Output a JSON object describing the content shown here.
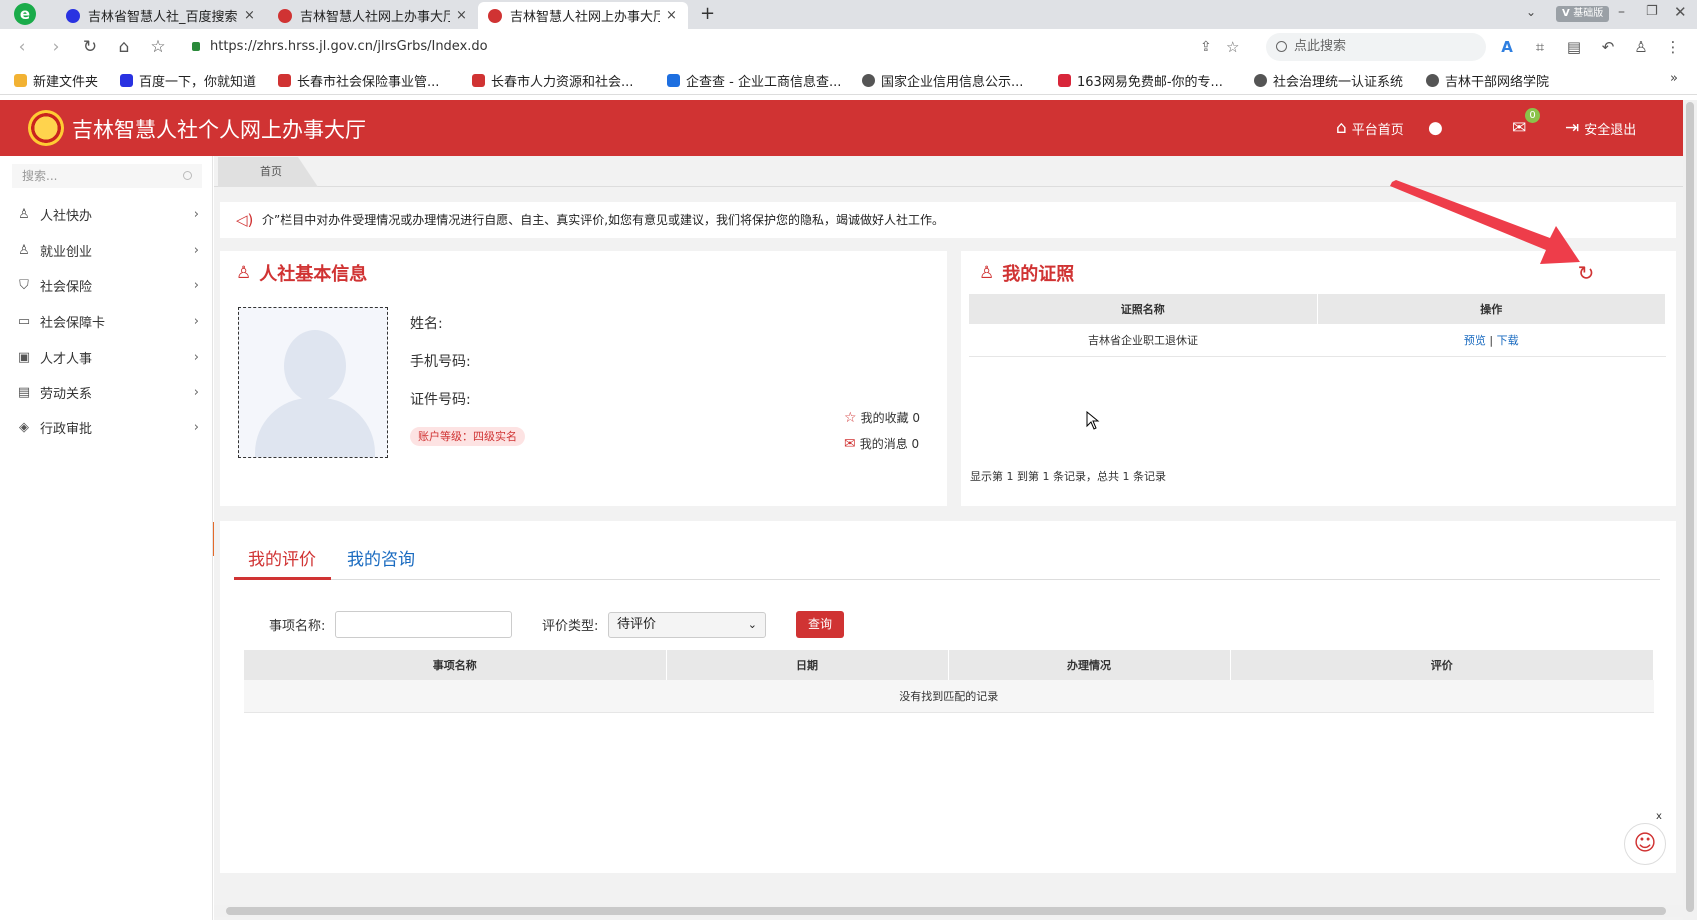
{
  "browser": {
    "tabs": [
      {
        "title": "吉林省智慧人社_百度搜索",
        "close": "×"
      },
      {
        "title": "吉林智慧人社网上办事大厅",
        "close": "×"
      },
      {
        "title": "吉林智慧人社网上办事大厅",
        "close": "×"
      }
    ],
    "new_tab": "+",
    "url": "https://zhrs.hrss.jl.gov.cn/jlrsGrbs/Index.do",
    "search_placeholder": "点此搜索",
    "version_badge": "基础版",
    "bookmarks": [
      "新建文件夹",
      "百度一下，你就知道",
      "长春市社会保险事业管...",
      "长春市人力资源和社会...",
      "企查查 - 企业工商信息查...",
      "国家企业信用信息公示...",
      "163网易免费邮-你的专...",
      "社会治理统一认证系统",
      "吉林干部网络学院"
    ]
  },
  "header": {
    "title": "吉林智慧人社个人网上办事大厅",
    "home_label": "平台首页",
    "message_count": "0",
    "logout_label": "安全退出"
  },
  "sidebar": {
    "search_placeholder": "搜索...",
    "items": [
      {
        "label": "人社快办",
        "icon": "user-icon"
      },
      {
        "label": "就业创业",
        "icon": "users-icon"
      },
      {
        "label": "社会保险",
        "icon": "shield-icon"
      },
      {
        "label": "社会保障卡",
        "icon": "card-icon"
      },
      {
        "label": "人才人事",
        "icon": "person-card-icon"
      },
      {
        "label": "劳动关系",
        "icon": "contract-icon"
      },
      {
        "label": "行政审批",
        "icon": "layers-icon"
      }
    ]
  },
  "breadcrumb": {
    "home": "首页"
  },
  "notice": "介”栏目中对办件受理情况或办理情况进行自愿、自主、真实评价,如您有意见或建议，我们将保护您的隐私，竭诚做好人社工作。",
  "basic_info": {
    "title": "人社基本信息",
    "name_label": "姓名:",
    "phone_label": "手机号码:",
    "id_label": "证件号码:",
    "account_level": "账户等级：四级实名",
    "favorites": "我的收藏 0",
    "messages": "我的消息 0"
  },
  "certificates": {
    "title": "我的证照",
    "columns": [
      "证照名称",
      "操作"
    ],
    "rows": [
      {
        "name": "吉林省企业职工退休证",
        "preview": "预览",
        "sep": "|",
        "download": "下载"
      }
    ],
    "page_info": "显示第 1 到第 1 条记录，总共 1 条记录"
  },
  "evaluation": {
    "tab_eval": "我的评价",
    "tab_consult": "我的咨询",
    "item_name_label": "事项名称:",
    "eval_type_label": "评价类型:",
    "eval_type_value": "待评价",
    "query_button": "查询",
    "columns": [
      "事项名称",
      "日期",
      "办理情况",
      "评价"
    ],
    "empty_text": "没有找到匹配的记录"
  },
  "colors": {
    "brand": "#d03333",
    "link": "#1a6bc0"
  }
}
